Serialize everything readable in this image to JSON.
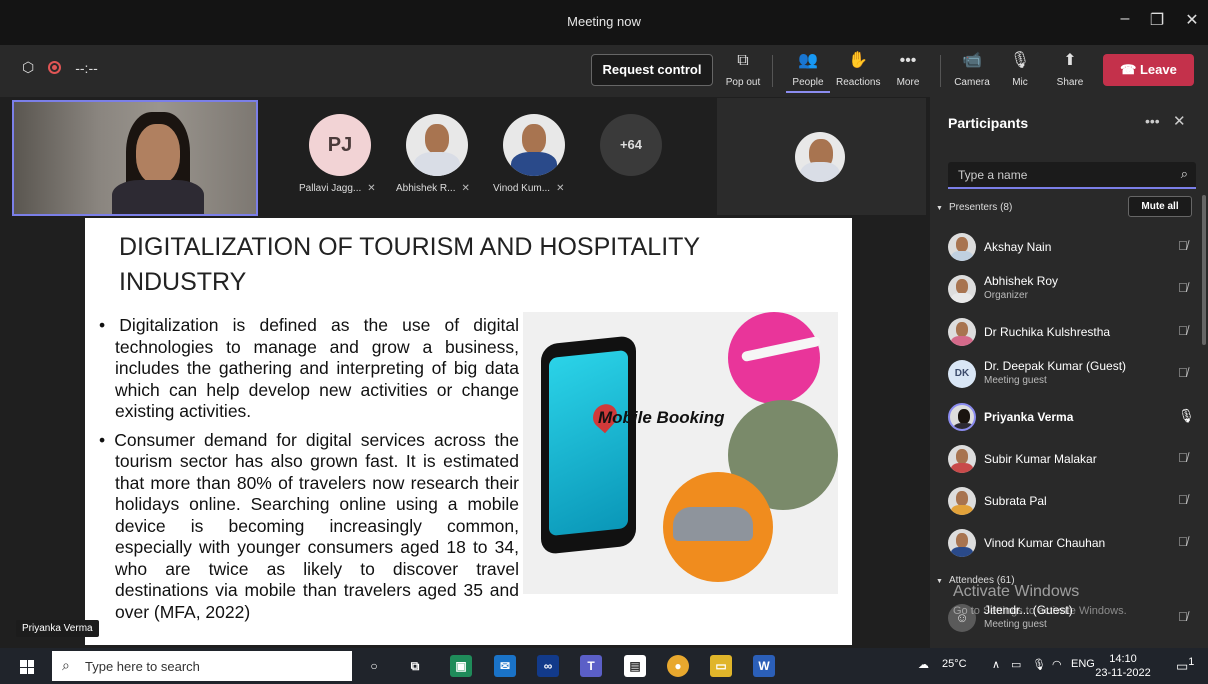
{
  "window": {
    "title": "Meeting now"
  },
  "toolbar": {
    "timer": "--:--",
    "request_control": "Request control",
    "popout": "Pop out",
    "people": "People",
    "reactions": "Reactions",
    "more": "More",
    "camera": "Camera",
    "mic": "Mic",
    "share": "Share",
    "leave": "Leave"
  },
  "gallery": {
    "pj_initials": "PJ",
    "names": [
      "Pallavi Jagg...",
      "Abhishek R...",
      "Vinod Kum..."
    ],
    "more_count": "+64"
  },
  "slide": {
    "title": "DIGITALIZATION OF TOURISM AND HOSPITALITY INDUSTRY",
    "bullets": [
      "Digitalization is defined as the use of digital technologies to manage and grow a business, includes the gathering and interpreting of big data which can help develop new activities or change existing activities.",
      "Consumer demand for digital services across the tourism sector has also grown fast. It is estimated that more than 80% of travelers now research their holidays online. Searching online using a mobile device is becoming increasingly common, especially with younger consumers aged 18 to 34, who are twice as likely to discover travel destinations via mobile than travelers aged 35 and over (MFA, 2022)"
    ],
    "image_label": "Mobile Booking"
  },
  "speaker_tag": "Priyanka Verma",
  "panel": {
    "title": "Participants",
    "search_placeholder": "Type a name",
    "presenters_label": "Presenters (8)",
    "mute_all": "Mute all",
    "attendees_label": "Attendees (61)",
    "participants": [
      {
        "name": "Akshay Nain",
        "role": ""
      },
      {
        "name": "Abhishek Roy",
        "role": "Organizer"
      },
      {
        "name": "Dr Ruchika Kulshrestha",
        "role": ""
      },
      {
        "name": "Dr. Deepak Kumar (Guest)",
        "role": "Meeting guest",
        "initials": "DK"
      },
      {
        "name": "Priyanka Verma",
        "role": ""
      },
      {
        "name": "Subir Kumar Malakar",
        "role": ""
      },
      {
        "name": "Subrata Pal",
        "role": ""
      },
      {
        "name": "Vinod Kumar Chauhan",
        "role": ""
      }
    ],
    "attendee": {
      "name": "Jitendr... (Guest)",
      "role": "Meeting guest"
    }
  },
  "watermark": {
    "line1": "Activate Windows",
    "line2": "Go to Settings to activate Windows."
  },
  "taskbar": {
    "search_placeholder": "Type here to search",
    "temperature": "25°C",
    "language": "ENG",
    "time": "14:10",
    "date": "23-11-2022",
    "notifications": "1"
  }
}
